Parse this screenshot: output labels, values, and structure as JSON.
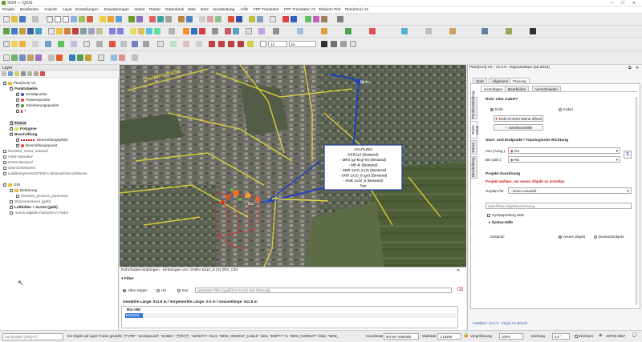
{
  "window": {
    "title": "2024 — QGIS",
    "controls": [
      "—",
      "☐",
      "✕"
    ]
  },
  "menu": [
    "Projekt",
    "Bearbeiten",
    "Ansicht",
    "Layer",
    "Einstellungen",
    "Erweiterungen",
    "Vektor",
    "Raster",
    "Datenbank",
    "Web",
    "Netz",
    "Verarbeitung",
    "Hilfe",
    "FPF Translator",
    "FPF Translator V2",
    "Telekom Plot",
    "Plan(Goo) V2"
  ],
  "toolbar": {
    "scale_input": "12",
    "unit_select": "px"
  },
  "layers_panel": {
    "title": "Layer",
    "items": [
      {
        "label": "Plan[Goo] V2",
        "style": "normal",
        "indent": 0,
        "checked": true
      },
      {
        "label": "Punktobjekte",
        "style": "bold",
        "indent": 1,
        "checked": true
      },
      {
        "label": "Schaltpunkte",
        "style": "normal",
        "indent": 2,
        "checked": true
      },
      {
        "label": "Trassenpunkte",
        "style": "normal",
        "indent": 2,
        "checked": true
      },
      {
        "label": "Orientierungspunkte",
        "style": "normal",
        "indent": 2,
        "checked": true
      },
      {
        "label": "?",
        "style": "normal",
        "indent": 2,
        "checked": true
      },
      {
        "label": "Trasse",
        "style": "bold",
        "indent": 1,
        "checked": true
      },
      {
        "label": "Polygone",
        "style": "bold",
        "indent": 1,
        "checked": true
      },
      {
        "label": "Beschriftung",
        "style": "bold",
        "indent": 1,
        "checked": true
      },
      {
        "label": "Beschriftungspfeile",
        "style": "normal",
        "indent": 2,
        "checked": true
      },
      {
        "label": "Beschriftungspunkt",
        "style": "normal",
        "indent": 2,
        "checked": true
      },
      {
        "label": "hoslafvd_street_network",
        "style": "italic",
        "indent": 0,
        "checked": false
      },
      {
        "label": "OSM Standard",
        "style": "italic",
        "indent": 0,
        "checked": false
      },
      {
        "label": "DGK5 Bestand",
        "style": "italic",
        "indent": 0,
        "checked": false
      },
      {
        "label": "Übersichtskarten",
        "style": "italic",
        "indent": 0,
        "checked": false
      },
      {
        "label": "Landkreisgrenzen/DTK50-V Bestand/Übersichtskarte",
        "style": "italic",
        "indent": 0,
        "checked": false
      },
      {
        "label": "GDI",
        "style": "normal",
        "indent": 0,
        "checked": true
      },
      {
        "label": "Befahrung",
        "style": "normal",
        "indent": 1,
        "checked": false
      },
      {
        "label": "hoslafvd_pictures_panorama",
        "style": "italic",
        "indent": 2,
        "checked": false
      },
      {
        "label": "Strassennamen (gelb)",
        "style": "italic",
        "indent": 1,
        "checked": false
      },
      {
        "label": "Luftbilder + ALKIS (gelb)",
        "style": "bold",
        "indent": 1,
        "checked": true
      },
      {
        "label": "ALKIS Digitale Flurkarte in Farbe",
        "style": "italic",
        "indent": 1,
        "checked": false
      }
    ]
  },
  "map": {
    "street_label": "Dreiwiesstraße",
    "node_label_top": "Moln",
    "node_label_bottom": "Kls",
    "popup": [
      "ACHTUNG",
      "KKR110 (Bestand)",
      "- MR4 (gr-kl-gr-kl) (Bestand)",
      "- MR-kl (Bestand)",
      "- SNR 1x10_8 (rt) (Bestand)",
      "- SNR 1x10_8 (gn) (Bestand)",
      "- SNR 1x10_8 (Bestand)",
      "Test"
    ]
  },
  "attr_panel": {
    "title": "Rohr/Kabel einbringen - Einbringen von 'SNRV 8x10_8 (S) (RO_CE)'",
    "filter_label": "Filter",
    "radio_all": "Alles zeigen",
    "radio_hk": "HK",
    "radio_kat": "Kat",
    "filter_placeholder": "optionaler Filter (qualifizen zur HK-Zeit-Filterung)",
    "summary": "Gewählte Länge: 811.8 m / Vorgemerkte Länge: 0.0 m / Gesamtlänge: 811.8 m",
    "column": "RU->RE",
    "cell": "KKR110"
  },
  "plugin_panel": {
    "title": "Plan[Goo] V2 - v2.2.9 - Eigenausbau (ab 2022)",
    "top_tabs": [
      "Start",
      "Allgemein",
      "Planung"
    ],
    "sub_tabs": [
      "Hinzufügen",
      "Bearbeiten",
      "Verschneiden"
    ],
    "side_tabs": [
      "Punktbearbeitung",
      "Rohre Kabel",
      "Trasse",
      "Beschriftung"
    ],
    "section_kabel": "Rohr oder Kabel?",
    "opt_rohr": "Rohr",
    "opt_kabel": "Kabel",
    "btn_rohr_menu": "Rohr-in-Rohr-Menü öffnen",
    "btn_selekt": "Selektionshilfe",
    "section_start_end": "Start- und Endpunkt / Topologische Richtung",
    "von_label": "Von (Ausg.):",
    "von_value": "RU",
    "bis_label": "Bis (ank.):",
    "bis_value": "RE",
    "swap_value": "⇅",
    "section_zuordnung": "Projekt-Zuordnung",
    "zuordnung_warning": "Projekt wählen, um neues Objekt zu erstellen",
    "geplant_label": "Geplant für",
    "geplant_value": "- keine Auswahl -",
    "bezeichnung_placeholder": "Kabel/Rohr-Objektbezeichnung",
    "syntax_check": "Syntaxprüfung aktiv",
    "syntax_hilfe": "Syntax-Hilfe",
    "zustand_label": "Zustand:",
    "opt_neu": "neues Objekt",
    "opt_bestand": "Bestandsobjekt",
    "footer": "Installiert: v2.2.9 - Plugin ist aktuell"
  },
  "status": {
    "search_placeholder": "Suchmaske (Strg+K)",
    "message": "Ein Objekt auf Layer Trasse gewählt: {\"TYPE\": \"underground\", \"KABEL\": \"[\"(RV)\"]\", \"LENGTH\": 811.8, \"NEW_HIGHEST_CABLE\": false, \"EMPTY\": 0, \"NEW_CONDUIT\": false, \"NEW_",
    "coord_label": "Koordinate",
    "coord_value": "857367 6990805",
    "scale_label": "Maßstab",
    "scale_value": "1:10569",
    "zoom_label": "Vergrößerung",
    "zoom_value": "100%",
    "rotation_label": "Drehung",
    "rotation_value": "0,0 °",
    "render_label": "Zeichnen",
    "crs_value": "EPSG:3857"
  }
}
